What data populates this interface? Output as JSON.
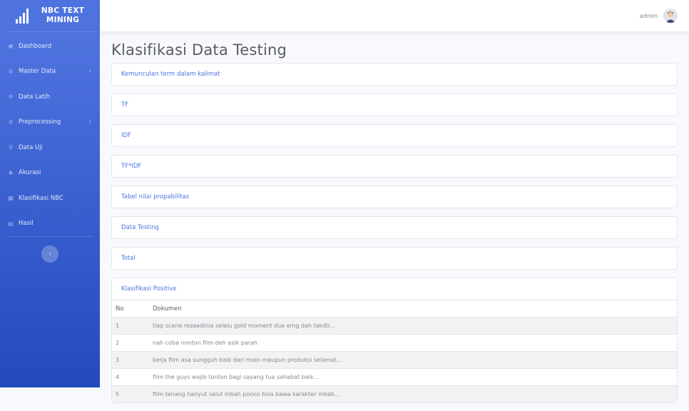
{
  "brand": {
    "title": "NBC TEXT MINING"
  },
  "sidebar": {
    "items": [
      {
        "label": "Dashboard",
        "icon": "dashboard-icon",
        "has_submenu": false
      },
      {
        "label": "Master Data",
        "icon": "gear-icon",
        "has_submenu": true
      },
      {
        "label": "Data Latih",
        "icon": "gear-icon",
        "has_submenu": false
      },
      {
        "label": "Preprocessing",
        "icon": "gear-icon",
        "has_submenu": true
      },
      {
        "label": "Data Uji",
        "icon": "user-icon",
        "has_submenu": false
      },
      {
        "label": "Akurasi",
        "icon": "bell-icon",
        "has_submenu": false
      },
      {
        "label": "Klasifikasi NBC",
        "icon": "table-icon",
        "has_submenu": false
      },
      {
        "label": "Hasil",
        "icon": "calendar-icon",
        "has_submenu": false
      }
    ]
  },
  "topbar": {
    "user_name": "admin"
  },
  "main": {
    "title": "Klasifikasi Data Testing",
    "cards": [
      "Kemunculan term dalam kalimat",
      "TF",
      "IDF",
      "TF*IDF",
      "Tabel nilai propabilitas",
      "Data Testing",
      "Total"
    ],
    "result_card": {
      "header": "Klasifikasi Positive",
      "columns": [
        "No",
        "Dokumen"
      ],
      "rows": [
        {
          "no": "1",
          "dokumen": "tiap scene rezaadinia selalu gold moment dua emg dah takdir..."
        },
        {
          "no": "2",
          "dokumen": "nah coba nonton film deh asik parah"
        },
        {
          "no": "3",
          "dokumen": "kerja film asa sungguh baik dari main maupun produksi selamat..."
        },
        {
          "no": "4",
          "dokumen": "film the guys wajib tonton bagi sayang tua sahabat baik..."
        },
        {
          "no": "5",
          "dokumen": "film tenang hanyut salut mbah ponco bisa bawa karakter mbah..."
        }
      ]
    }
  },
  "colors": {
    "primary": "#4e73df",
    "sidebar_end": "#224abe",
    "text": "#858796",
    "title": "#5a5c69"
  }
}
